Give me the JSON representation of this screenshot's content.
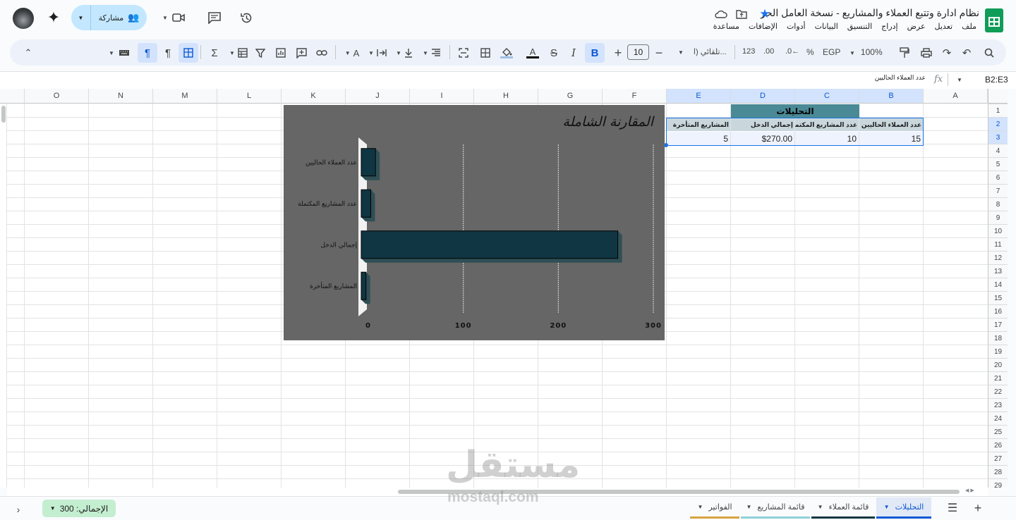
{
  "title_bar": {
    "doc_title": "نظام ادارة وتتبع العملاء والمشاريع - نسخة العامل الحر",
    "menus": [
      "ملف",
      "تعديل",
      "عرض",
      "إدراج",
      "التنسيق",
      "البيانات",
      "أدوات",
      "الإضافات",
      "مساعدة"
    ],
    "share_label": "مشاركة"
  },
  "toolbar": {
    "zoom": "100%",
    "currency": "EGP",
    "percent": "%",
    "dec_decrease": ".0←",
    "dec_increase": ".00",
    "number_format": "123",
    "font": "تلقائي (ا...",
    "font_size": "10",
    "bold": "B",
    "italic": "I",
    "strike": "S",
    "text_color": "A"
  },
  "formula_bar": {
    "name_box": "B2:E3",
    "fx": "fx",
    "content": "عدد العملاء الحاليين"
  },
  "columns": [
    "A",
    "B",
    "C",
    "D",
    "E",
    "F",
    "G",
    "H",
    "I",
    "J",
    "K",
    "L",
    "M",
    "N",
    "O"
  ],
  "rows": [
    "1",
    "2",
    "3",
    "4",
    "5",
    "6",
    "7",
    "8",
    "9",
    "10",
    "11",
    "12",
    "13",
    "14",
    "15",
    "16",
    "17",
    "18",
    "19",
    "20",
    "21",
    "22",
    "23",
    "24",
    "25",
    "26",
    "27",
    "28",
    "29"
  ],
  "sheet": {
    "header_title": "التحليلات",
    "headers": [
      "عدد العملاء الحاليين",
      "عدد المشاريع المكتملة",
      "إجمالي الدخل",
      "المشاريع المتأخرة"
    ],
    "values": [
      "15",
      "10",
      "$270.00",
      "5"
    ]
  },
  "chart_data": {
    "type": "bar",
    "orientation": "horizontal",
    "title": "المقارنة الشاملة",
    "categories": [
      "عدد العملاء الحاليين",
      "عدد المشاريع المكتملة",
      "إجمالي الدخل",
      "المشاريع المتأخرة"
    ],
    "values": [
      15,
      10,
      270,
      5
    ],
    "xlim": [
      0,
      300
    ],
    "ticks": [
      "0",
      "100",
      "200",
      "300"
    ],
    "bar_color": "#0f3642",
    "background": "#666666",
    "grid": true,
    "legend": "none"
  },
  "bottom": {
    "total_label": "الإجمالي: 300",
    "tabs": [
      "التحليلات",
      "قائمة العملاء",
      "قائمة المشاريع",
      "الفواتير"
    ],
    "watermark_brand": "مستقل",
    "watermark_url": "mostaql.com"
  },
  "colors": {
    "accent": "#0b57d0",
    "selection": "#d3e3fd",
    "header_teal": "#4a8a96",
    "header_row": "#c9d7dd",
    "sheets_green": "#0f9d58",
    "total_chip": "#c4eed0"
  }
}
